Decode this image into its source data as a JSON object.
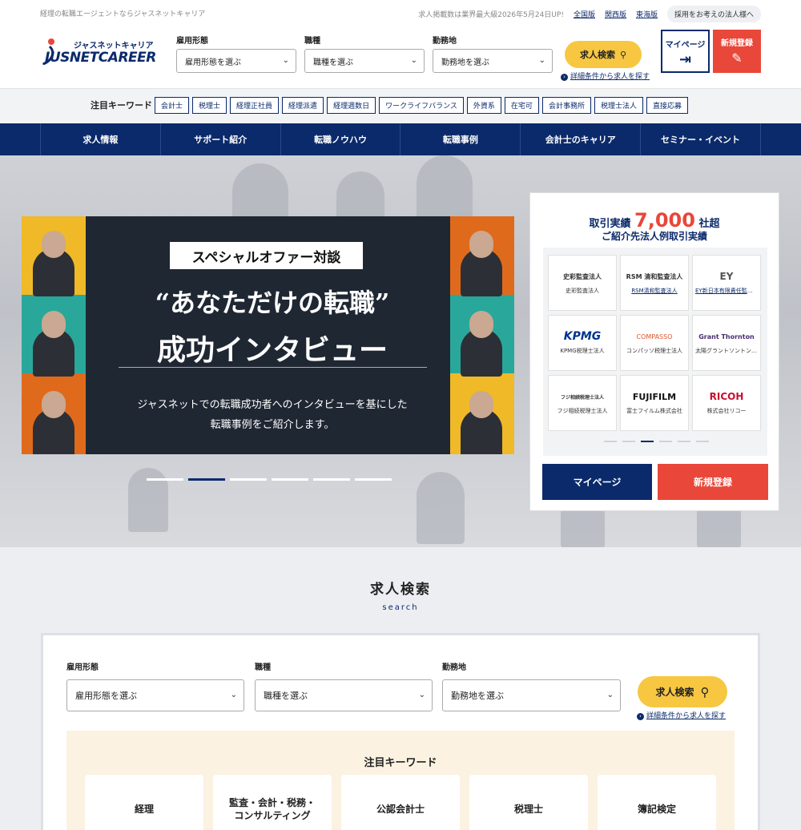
{
  "topbar": {
    "tagline": "経理の転職エージェントならジャスネットキャリア",
    "count_text": "求人掲載数は業界最大級2026年5月24日UP!",
    "links": [
      "全国版",
      "関西版",
      "東海版"
    ],
    "corp_button": "採用をお考えの法人様へ"
  },
  "logo": {
    "kana": "ジャスネットキャリア",
    "text": "JUSNETCAREER"
  },
  "header_search": {
    "fields": [
      {
        "label": "雇用形態",
        "value": "雇用形態を選ぶ"
      },
      {
        "label": "職種",
        "value": "職種を選ぶ"
      },
      {
        "label": "勤務地",
        "value": "勤務地を選ぶ"
      }
    ],
    "button": "求人検索",
    "advanced": "詳細条件から求人を探す"
  },
  "account": {
    "mypage": "マイページ",
    "register": "新規登録"
  },
  "keywords": {
    "label": "注目キーワード",
    "items": [
      "会計士",
      "税理士",
      "経理正社員",
      "経理派遣",
      "経理週数日",
      "ワークライフバランス",
      "外資系",
      "在宅可",
      "会計事務所",
      "税理士法人",
      "直接応募"
    ]
  },
  "nav": {
    "items": [
      "求人情報",
      "サポート紹介",
      "転職ノウハウ",
      "転職事例",
      "会計士のキャリア",
      "セミナー・イベント"
    ]
  },
  "banner": {
    "tag": "スペシャルオファー対談",
    "title1": "“あなただけの転職”",
    "title2": "成功インタビュー",
    "desc1": "ジャスネットでの転職成功者へのインタビューを基にした",
    "desc2": "転職事例をご紹介します。",
    "active_slide": 2
  },
  "clients": {
    "title_pre": "取引実績",
    "count": "7,000",
    "title_post": "社超",
    "subtitle": "ご紹介先法人例取引実績",
    "items": [
      {
        "logo": "史彩監査法人",
        "name": "史彩監査法人"
      },
      {
        "logo": "RSM 清和監査法人",
        "name": "RSM清和監査法人"
      },
      {
        "logo": "EY",
        "name": "EY新日本有限責任監査法人"
      },
      {
        "logo": "KPMG",
        "name": "KPMG税理士法人"
      },
      {
        "logo": "COMPASSO",
        "name": "コンパッソ税理士法人"
      },
      {
        "logo": "Grant Thornton",
        "name": "太陽グラントソントン税理士法人"
      },
      {
        "logo": "フジ相続税理士法人",
        "name": "フジ相続税理士法人"
      },
      {
        "logo": "FUJIFILM",
        "name": "富士フイルム株式会社"
      },
      {
        "logo": "RICOH",
        "name": "株式会社リコー"
      }
    ],
    "active_dot": 2,
    "mypage": "マイページ",
    "register": "新規登録"
  },
  "search_section": {
    "title": "求人検索",
    "subtitle": "search",
    "fields": [
      {
        "label": "雇用形態",
        "value": "雇用形態を選ぶ"
      },
      {
        "label": "職種",
        "value": "職種を選ぶ"
      },
      {
        "label": "勤務地",
        "value": "勤務地を選ぶ"
      }
    ],
    "button": "求人検索",
    "advanced": "詳細条件から求人を探す",
    "kw_title": "注目キーワード",
    "kw_cards": [
      "経理",
      "監査・会計・税務・\nコンサルティング",
      "公認会計士",
      "税理士",
      "簿記検定"
    ]
  },
  "colors": {
    "navy": "#0b2a6b",
    "red": "#e8473a",
    "yellow": "#f7c742"
  }
}
